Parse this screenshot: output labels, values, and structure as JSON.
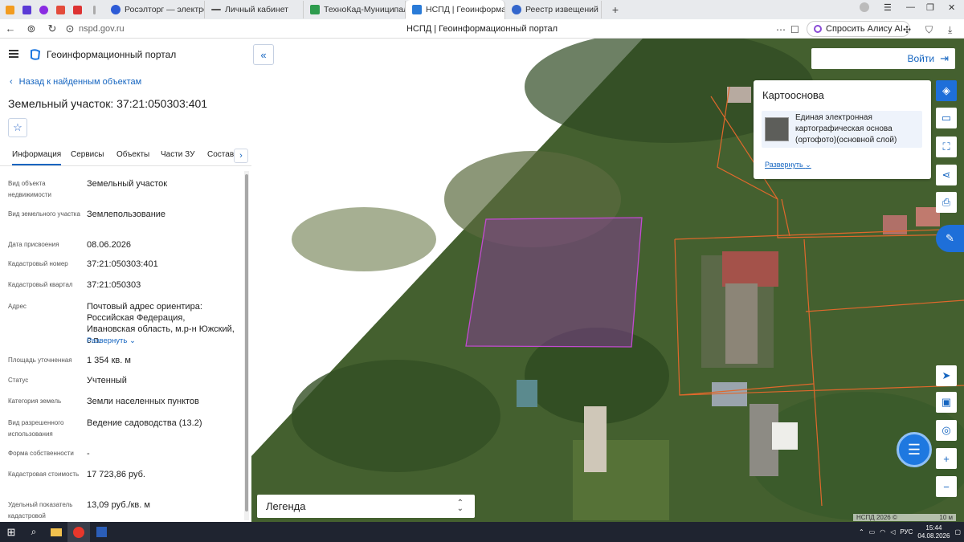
{
  "browser": {
    "tabs": [
      {
        "label": "Росэлторг — электронна",
        "close": "×"
      },
      {
        "label": "Личный кабинет",
        "close": "×"
      },
      {
        "label": "ТехноКад-Муниципалите",
        "close": "×"
      },
      {
        "label": "НСПД | Геоинформац",
        "close": "×"
      },
      {
        "label": "Реестр извещений",
        "close": "×"
      }
    ],
    "url": "nspd.gov.ru",
    "page_title": "НСПД | Геоинформационный портал",
    "alisa_label": "Спросить Алису AI"
  },
  "panel": {
    "app_title": "Геоинформационный портал",
    "back_label": "Назад к найденным объектам",
    "object_title": "Земельный участок: 37:21:050303:401",
    "tabs": [
      "Информация",
      "Сервисы",
      "Объекты",
      "Части ЗУ",
      "Состав"
    ],
    "fields": [
      {
        "label": "Вид объекта недвижимости",
        "value": "Земельный участок"
      },
      {
        "label": "Вид земельного участка",
        "value": "Землепользование"
      },
      {
        "label": "Дата присвоения",
        "value": "08.06.2026"
      },
      {
        "label": "Кадастровый номер",
        "value": "37:21:050303:401"
      },
      {
        "label": "Кадастровый квартал",
        "value": "37:21:050303"
      },
      {
        "label": "Адрес",
        "value": "Почтовый адрес ориентира: Российская Федерация, Ивановская область, м.р-н Южский, с.п.",
        "expand": "Развернуть"
      },
      {
        "label": "Площадь уточненная",
        "value": "1 354 кв. м"
      },
      {
        "label": "Статус",
        "value": "Учтенный"
      },
      {
        "label": "Категория земель",
        "value": "Земли населенных пунктов"
      },
      {
        "label": "Вид разрешенного использования",
        "value": "Ведение садоводства (13.2)"
      },
      {
        "label": "Форма собственности",
        "value": "-"
      },
      {
        "label": "Кадастровая стоимость",
        "value": "17 723,86 руб."
      },
      {
        "label": "Удельный показатель кадастровой",
        "value": "13,09 руб./кв. м"
      }
    ]
  },
  "map": {
    "login_label": "Войти",
    "basemap_title": "Картооснова",
    "basemap_layer": "Единая электронная картографическая основа (ортофото)(основной слой)",
    "basemap_expand": "Развернуть",
    "legend_label": "Легенда",
    "copyright": "НСПД 2026 ©",
    "scale_label": "10 м",
    "parcel_color": "#b03fb4"
  },
  "taskbar": {
    "lang": "РУС",
    "time": "15:44",
    "date": "04.08.2026"
  }
}
